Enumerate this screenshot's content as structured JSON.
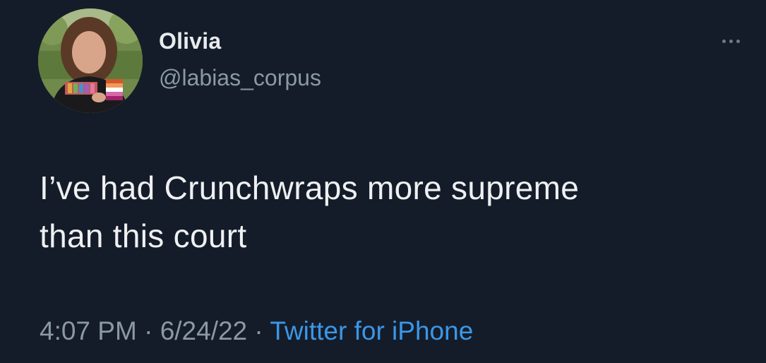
{
  "author": {
    "display_name": "Olivia",
    "handle": "@labias_corpus"
  },
  "menu": {
    "icon": "more-horizontal-icon"
  },
  "tweet": {
    "text_line1": "I’ve had Crunchwraps more supreme",
    "text_line2": "than this court"
  },
  "meta": {
    "time": "4:07 PM",
    "separator": " · ",
    "date": "6/24/22",
    "source": "Twitter for iPhone"
  },
  "colors": {
    "background": "#151c29",
    "text": "#e8ebee",
    "secondary": "#8b98a5",
    "link": "#3b97e8"
  }
}
